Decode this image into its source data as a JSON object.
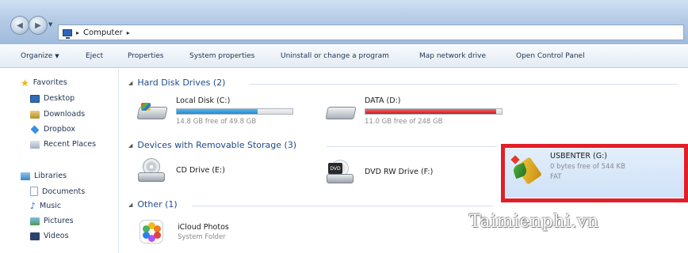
{
  "address": {
    "crumb": "Computer"
  },
  "toolbar": {
    "organize": "Organize",
    "eject": "Eject",
    "properties": "Properties",
    "system_properties": "System properties",
    "uninstall": "Uninstall or change a program",
    "map_network": "Map network drive",
    "open_control_panel": "Open Control Panel"
  },
  "nav": {
    "favorites": "Favorites",
    "favorites_items": [
      "Desktop",
      "Downloads",
      "Dropbox",
      "Recent Places"
    ],
    "libraries": "Libraries",
    "libraries_items": [
      "Documents",
      "Music",
      "Pictures",
      "Videos"
    ]
  },
  "groups": {
    "hdd": "Hard Disk Drives (2)",
    "removable": "Devices with Removable Storage (3)",
    "other": "Other (1)"
  },
  "drives": {
    "c": {
      "name": "Local Disk (C:)",
      "free": "14.8 GB free of 49.8 GB",
      "used_fraction": 0.7
    },
    "d": {
      "name": "DATA (D:)",
      "free": "11.0 GB free of 248 GB",
      "used_fraction": 0.96
    },
    "e": {
      "name": "CD Drive (E:)"
    },
    "f": {
      "name": "DVD RW Drive (F:)",
      "badge": "DVD"
    },
    "g": {
      "name": "USBENTER (G:)",
      "free": "0 bytes free of 544 KB",
      "fs": "FAT"
    }
  },
  "other_items": {
    "icloud": {
      "name": "iCloud Photos",
      "sub": "System Folder"
    }
  },
  "watermark": "Taimienphi.vn",
  "colors": {
    "highlight": "#e21e28",
    "bar_blue": "#1f8ad0",
    "bar_red": "#cc1b1b"
  }
}
